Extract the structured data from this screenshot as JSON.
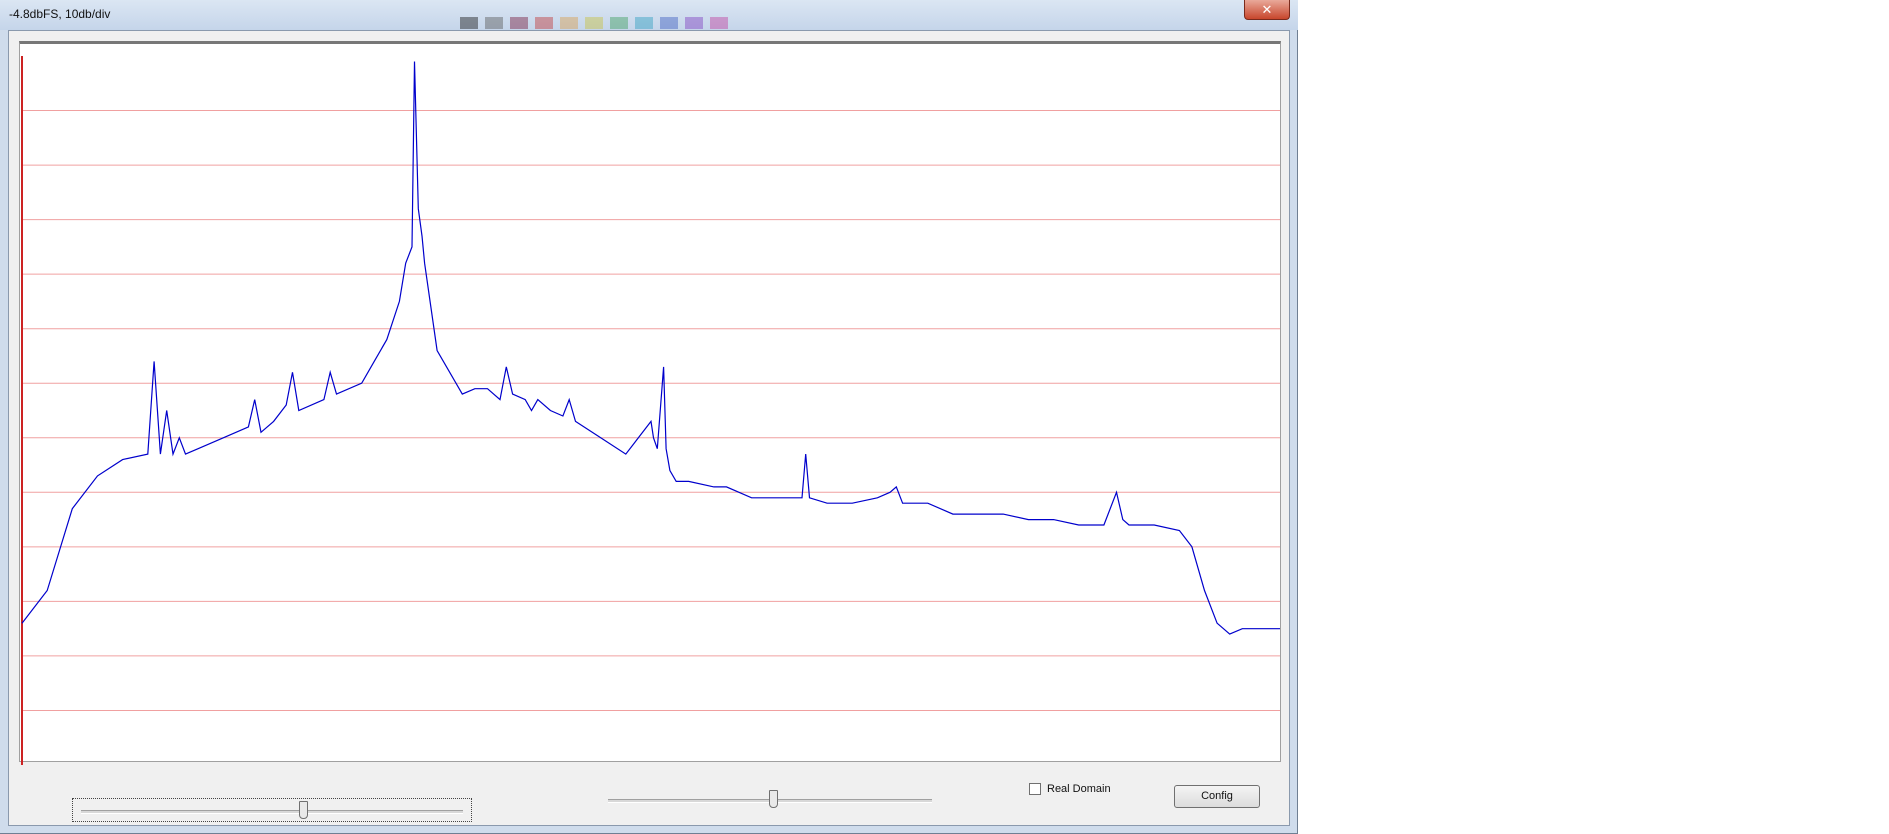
{
  "window": {
    "title": "-4.8dbFS, 10db/div",
    "close_label": "✕"
  },
  "toolbar_swatches": [
    "#1a1a1a",
    "#5a5a5a",
    "#7a2040",
    "#c03a3a",
    "#d9a050",
    "#c8c040",
    "#40a060",
    "#30a0c0",
    "#4060c0",
    "#8040c0",
    "#c040a0"
  ],
  "controls": {
    "checkbox_label": "Real Domain",
    "checkbox_checked": false,
    "config_label": "Config",
    "left_slider_value": 0.58,
    "center_slider_value": 0.51
  },
  "chart_data": {
    "type": "line",
    "title": "",
    "xlabel": "",
    "ylabel": "",
    "grid": "horizontal",
    "grid_divisions": 13,
    "ylim": [
      -130,
      0
    ],
    "series": [
      {
        "color": "#0000cc",
        "x": [
          0,
          0.02,
          0.04,
          0.06,
          0.08,
          0.1,
          0.105,
          0.11,
          0.115,
          0.12,
          0.125,
          0.13,
          0.14,
          0.16,
          0.18,
          0.185,
          0.19,
          0.2,
          0.21,
          0.215,
          0.22,
          0.24,
          0.245,
          0.25,
          0.27,
          0.28,
          0.29,
          0.3,
          0.305,
          0.31,
          0.312,
          0.315,
          0.318,
          0.32,
          0.33,
          0.34,
          0.35,
          0.36,
          0.37,
          0.38,
          0.385,
          0.39,
          0.4,
          0.405,
          0.41,
          0.42,
          0.43,
          0.435,
          0.44,
          0.46,
          0.48,
          0.5,
          0.502,
          0.505,
          0.51,
          0.512,
          0.515,
          0.52,
          0.53,
          0.55,
          0.56,
          0.58,
          0.6,
          0.62,
          0.623,
          0.626,
          0.64,
          0.66,
          0.68,
          0.69,
          0.695,
          0.7,
          0.72,
          0.74,
          0.76,
          0.78,
          0.8,
          0.82,
          0.84,
          0.86,
          0.87,
          0.875,
          0.88,
          0.9,
          0.92,
          0.93,
          0.94,
          0.95,
          0.96,
          0.97,
          0.98,
          1.0
        ],
        "y": [
          -104,
          -98,
          -83,
          -77,
          -74,
          -73,
          -56,
          -73,
          -65,
          -73,
          -70,
          -73,
          -72,
          -70,
          -68,
          -63,
          -69,
          -67,
          -64,
          -58,
          -65,
          -63,
          -58,
          -62,
          -60,
          -56,
          -52,
          -45,
          -38,
          -35,
          -1,
          -28,
          -33,
          -38,
          -54,
          -58,
          -62,
          -61,
          -61,
          -63,
          -57,
          -62,
          -63,
          -65,
          -63,
          -65,
          -66,
          -63,
          -67,
          -70,
          -73,
          -67,
          -70,
          -72,
          -57,
          -72,
          -76,
          -78,
          -78,
          -79,
          -79,
          -81,
          -81,
          -81,
          -73,
          -81,
          -82,
          -82,
          -81,
          -80,
          -79,
          -82,
          -82,
          -84,
          -84,
          -84,
          -85,
          -85,
          -86,
          -86,
          -80,
          -85,
          -86,
          -86,
          -87,
          -90,
          -98,
          -104,
          -106,
          -105,
          -105,
          -105
        ]
      }
    ]
  }
}
